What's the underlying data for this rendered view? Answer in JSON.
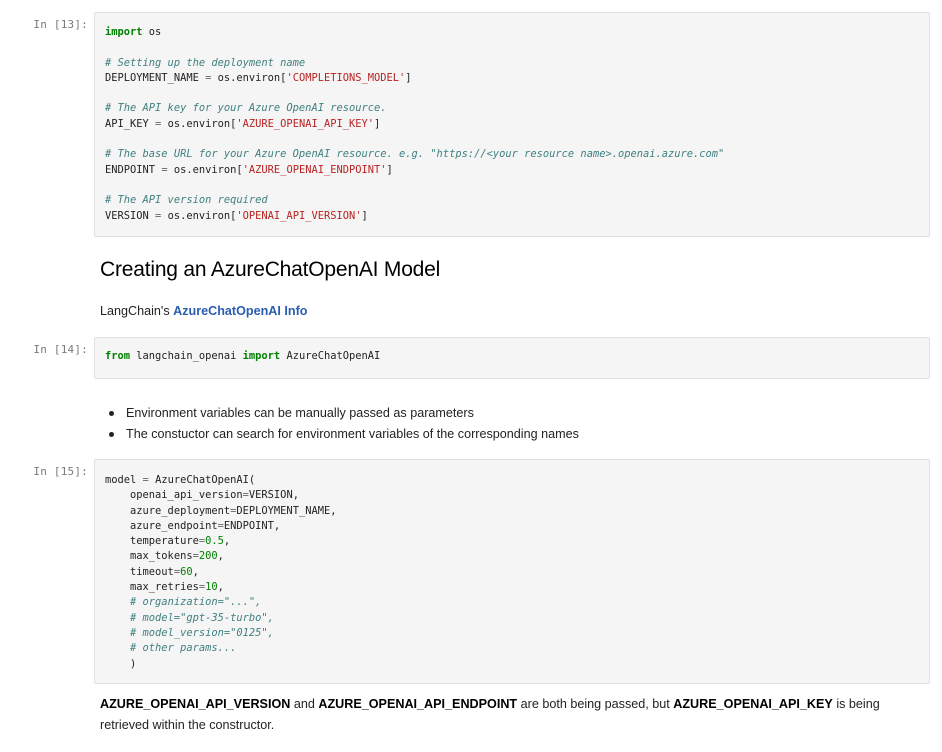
{
  "cells": [
    {
      "prompt": "In [13]:",
      "lines": [
        [
          [
            "kw",
            "import"
          ],
          [
            "tx",
            " os"
          ]
        ],
        [
          [
            "tx",
            ""
          ]
        ],
        [
          [
            "cm",
            "# Setting up the deployment name"
          ]
        ],
        [
          [
            "tx",
            "DEPLOYMENT_NAME "
          ],
          [
            "op",
            "="
          ],
          [
            "tx",
            " os.environ["
          ],
          [
            "st",
            "'COMPLETIONS_MODEL'"
          ],
          [
            "tx",
            "]"
          ]
        ],
        [
          [
            "tx",
            ""
          ]
        ],
        [
          [
            "cm",
            "# The API key for your Azure OpenAI resource."
          ]
        ],
        [
          [
            "tx",
            "API_KEY "
          ],
          [
            "op",
            "="
          ],
          [
            "tx",
            " os.environ["
          ],
          [
            "st",
            "'AZURE_OPENAI_API_KEY'"
          ],
          [
            "tx",
            "]"
          ]
        ],
        [
          [
            "tx",
            ""
          ]
        ],
        [
          [
            "cm",
            "# The base URL for your Azure OpenAI resource. e.g. \"https://<your resource name>.openai.azure.com\""
          ]
        ],
        [
          [
            "tx",
            "ENDPOINT "
          ],
          [
            "op",
            "="
          ],
          [
            "tx",
            " os.environ["
          ],
          [
            "st",
            "'AZURE_OPENAI_ENDPOINT'"
          ],
          [
            "tx",
            "]"
          ]
        ],
        [
          [
            "tx",
            ""
          ]
        ],
        [
          [
            "cm",
            "# The API version required"
          ]
        ],
        [
          [
            "tx",
            "VERSION "
          ],
          [
            "op",
            "="
          ],
          [
            "tx",
            " os.environ["
          ],
          [
            "st",
            "'OPENAI_API_VERSION'"
          ],
          [
            "tx",
            "]"
          ]
        ]
      ]
    },
    {
      "prompt": "In [14]:",
      "lines": [
        [
          [
            "kw",
            "from"
          ],
          [
            "tx",
            " langchain_openai "
          ],
          [
            "kw",
            "import"
          ],
          [
            "tx",
            " AzureChatOpenAI"
          ]
        ]
      ]
    },
    {
      "prompt": "In [15]:",
      "lines": [
        [
          [
            "tx",
            "model "
          ],
          [
            "op",
            "="
          ],
          [
            "tx",
            " AzureChatOpenAI("
          ]
        ],
        [
          [
            "tx",
            "    openai_api_version"
          ],
          [
            "op",
            "="
          ],
          [
            "tx",
            "VERSION,"
          ]
        ],
        [
          [
            "tx",
            "    azure_deployment"
          ],
          [
            "op",
            "="
          ],
          [
            "tx",
            "DEPLOYMENT_NAME,"
          ]
        ],
        [
          [
            "tx",
            "    azure_endpoint"
          ],
          [
            "op",
            "="
          ],
          [
            "tx",
            "ENDPOINT,"
          ]
        ],
        [
          [
            "tx",
            "    temperature"
          ],
          [
            "op",
            "="
          ],
          [
            "nm",
            "0.5"
          ],
          [
            "tx",
            ","
          ]
        ],
        [
          [
            "tx",
            "    max_tokens"
          ],
          [
            "op",
            "="
          ],
          [
            "nm",
            "200"
          ],
          [
            "tx",
            ","
          ]
        ],
        [
          [
            "tx",
            "    timeout"
          ],
          [
            "op",
            "="
          ],
          [
            "nm",
            "60"
          ],
          [
            "tx",
            ","
          ]
        ],
        [
          [
            "tx",
            "    max_retries"
          ],
          [
            "op",
            "="
          ],
          [
            "nm",
            "10"
          ],
          [
            "tx",
            ","
          ]
        ],
        [
          [
            "tx",
            "    "
          ],
          [
            "cm",
            "# organization=\"...\","
          ]
        ],
        [
          [
            "tx",
            "    "
          ],
          [
            "cm",
            "# model=\"gpt-35-turbo\","
          ]
        ],
        [
          [
            "tx",
            "    "
          ],
          [
            "cm",
            "# model_version=\"0125\","
          ]
        ],
        [
          [
            "tx",
            "    "
          ],
          [
            "cm",
            "# other params..."
          ]
        ],
        [
          [
            "tx",
            "    )"
          ]
        ]
      ]
    }
  ],
  "heading": "Creating an AzureChatOpenAI Model",
  "info_prefix": "LangChain's ",
  "info_link": "AzureChatOpenAI Info",
  "bullets": [
    "Environment variables can be manually passed as parameters",
    "The constuctor can search for environment variables of the corresponding names"
  ],
  "final": {
    "b1": "AZURE_OPENAI_API_VERSION",
    "t1": " and ",
    "b2": "AZURE_OPENAI_API_ENDPOINT",
    "t2": " are both being passed, but ",
    "b3": "AZURE_OPENAI_API_KEY",
    "t3": " is being",
    "line2": "retrieved within the constructor."
  },
  "colors": {
    "keyword": "#008000",
    "comment": "#408080",
    "string": "#ba2121",
    "link": "#2a5db0",
    "code_bg": "#f5f5f5"
  }
}
